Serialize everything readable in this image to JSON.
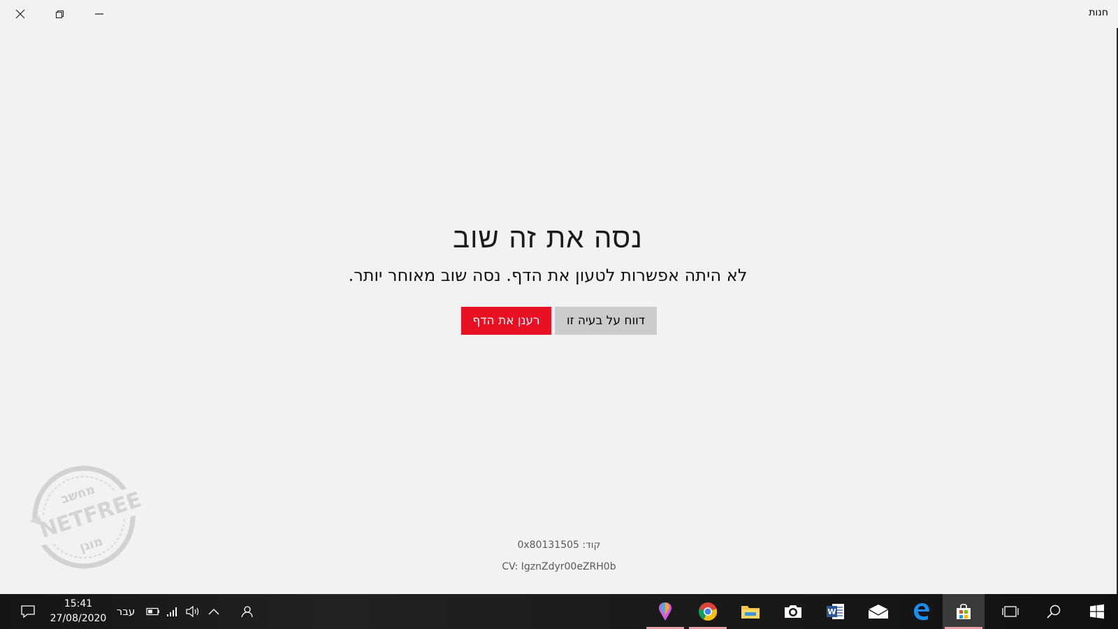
{
  "window": {
    "title": "חנות",
    "controls": {
      "close": "close",
      "restore": "restore",
      "minimize": "minimize"
    }
  },
  "error": {
    "title": "נסה את זה שוב",
    "message": "לא היתה אפשרות לטעון את הדף. נסה שוב מאוחר יותר.",
    "refresh_label": "רענן את הדף",
    "report_label": "דווח על בעיה זו",
    "code_line": "קוד: 0x80131505",
    "cv_line": "CV: IgznZdyr00eZRH0b"
  },
  "watermark": {
    "top_text": "מחשב",
    "middle_text": "NETFREE",
    "bottom_text": "מוגן"
  },
  "taskbar": {
    "time": "15:41",
    "date": "27/08/2020",
    "language": "עבר",
    "tray_icons": [
      "battery-icon",
      "signal-icon",
      "volume-icon",
      "chevron-up-icon",
      "people-icon"
    ],
    "apps": [
      "paint3d-icon",
      "chrome-icon",
      "file-explorer-icon",
      "camera-icon",
      "word-icon",
      "mail-icon",
      "edge-icon",
      "store-icon",
      "task-view-icon",
      "search-icon",
      "start-icon"
    ],
    "active_app": "store-icon"
  },
  "colors": {
    "accent_red": "#e81123",
    "button_gray": "#cccccc",
    "background": "#f2f2f2"
  }
}
